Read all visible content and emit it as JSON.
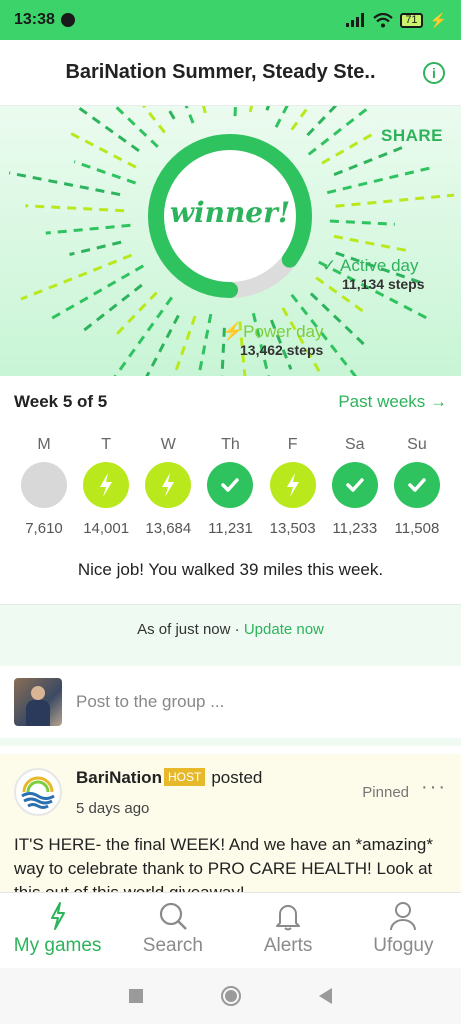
{
  "status_bar": {
    "time": "13:38",
    "battery": "71"
  },
  "header": {
    "title": "BariNation Summer, Steady Ste..",
    "info_icon": "info-icon"
  },
  "hero": {
    "share_label": "SHARE",
    "center_text": "winner!",
    "ring_progress": 0.85,
    "active_day": {
      "label": "Active day",
      "steps": "11,134 steps"
    },
    "power_day": {
      "label": "Power day",
      "steps": "13,462 steps"
    },
    "colors": {
      "ring": "#2fc35f",
      "power": "#b9e81d",
      "accent": "#2db35b"
    }
  },
  "week": {
    "title": "Week 5 of 5",
    "past_weeks_label": "Past weeks →",
    "days": [
      {
        "label": "M",
        "steps": "7,610",
        "status": "none"
      },
      {
        "label": "T",
        "steps": "14,001",
        "status": "power"
      },
      {
        "label": "W",
        "steps": "13,684",
        "status": "power"
      },
      {
        "label": "Th",
        "steps": "11,231",
        "status": "active"
      },
      {
        "label": "F",
        "steps": "13,503",
        "status": "power"
      },
      {
        "label": "Sa",
        "steps": "11,233",
        "status": "active"
      },
      {
        "label": "Su",
        "steps": "11,508",
        "status": "active"
      }
    ],
    "summary": "Nice job! You walked 39 miles this week."
  },
  "sync": {
    "prefix": "As of just now · ",
    "link": "Update now"
  },
  "composer": {
    "placeholder": "Post to the group ..."
  },
  "feed": {
    "author": "BariNation",
    "badge": "HOST",
    "action": "posted",
    "time": "5 days ago",
    "pinned": "Pinned",
    "more": "···",
    "body": "IT'S HERE- the final WEEK! And we have an *amazing* way to celebrate thank to PRO CARE HEALTH! Look at this out of this world giveaway!"
  },
  "bottom_nav": {
    "items": [
      {
        "label": "My games",
        "icon": "lightning-icon"
      },
      {
        "label": "Search",
        "icon": "search-icon"
      },
      {
        "label": "Alerts",
        "icon": "bell-icon"
      },
      {
        "label": "Ufoguy",
        "icon": "person-icon"
      }
    ]
  }
}
